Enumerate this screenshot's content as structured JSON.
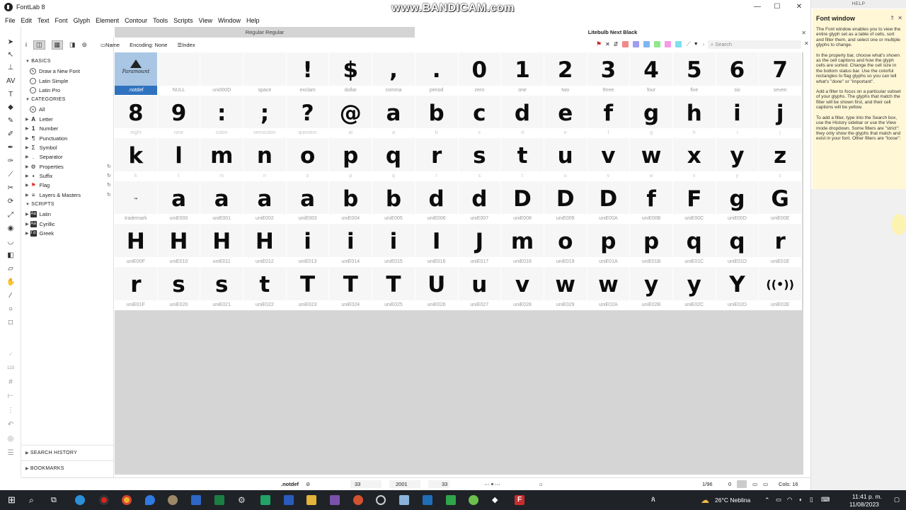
{
  "window": {
    "title": "FontLab 8",
    "minimize": "—",
    "maximize": "☐",
    "close": "✕"
  },
  "watermark": "www.BANDICAM.com",
  "menu": [
    "File",
    "Edit",
    "Text",
    "Font",
    "Glyph",
    "Element",
    "Contour",
    "Tools",
    "Scripts",
    "View",
    "Window",
    "Help"
  ],
  "tabs": {
    "regular": "Regular Regular",
    "litebulb": "Litebulb Next Black"
  },
  "propbar": {
    "info": "i",
    "name": "Name",
    "encoding": "Encoding: None",
    "index": "Index"
  },
  "search": {
    "placeholder": "Search"
  },
  "sidebar": {
    "basics_header": "BASICS",
    "basics": [
      "Draw a New Font",
      "Latin Simple",
      "Latin Pro"
    ],
    "categories_header": "CATEGORIES",
    "categories": [
      {
        "label": "All",
        "icon": "all"
      },
      {
        "label": "Letter",
        "icon": "A"
      },
      {
        "label": "Number",
        "icon": "1"
      },
      {
        "label": "Punctuation",
        "icon": "¶"
      },
      {
        "label": "Symbol",
        "icon": "Σ"
      },
      {
        "label": "Separator",
        "icon": "."
      },
      {
        "label": "Properties",
        "icon": "⚙"
      },
      {
        "label": "Suffix",
        "icon": "▪"
      },
      {
        "label": "Flag",
        "icon": "⚑"
      },
      {
        "label": "Layers & Masters",
        "icon": "≡"
      }
    ],
    "scripts_header": "SCRIPTS",
    "scripts": [
      {
        "label": "Latin",
        "icon": "Aa"
      },
      {
        "label": "Cyrillic",
        "icon": "Аа"
      },
      {
        "label": "Greek",
        "icon": "Γα"
      }
    ],
    "search_history": "SEARCH HISTORY",
    "bookmarks": "BOOKMARKS"
  },
  "glyphs": [
    {
      "g": "",
      "name": ".notdef",
      "special": "logo",
      "selected": true
    },
    {
      "g": "",
      "name": "NULL"
    },
    {
      "g": "",
      "name": "uni000D"
    },
    {
      "g": "",
      "name": "space"
    },
    {
      "g": "!",
      "name": "exclam"
    },
    {
      "g": "$",
      "name": "dollar"
    },
    {
      "g": ",",
      "name": "comma"
    },
    {
      "g": ".",
      "name": "period"
    },
    {
      "g": "0",
      "name": "zero"
    },
    {
      "g": "1",
      "name": "one"
    },
    {
      "g": "2",
      "name": "two"
    },
    {
      "g": "3",
      "name": "three"
    },
    {
      "g": "4",
      "name": "four"
    },
    {
      "g": "5",
      "name": "five"
    },
    {
      "g": "6",
      "name": "six"
    },
    {
      "g": "7",
      "name": "seven"
    },
    {
      "g": "8",
      "name": "eight",
      "faint": true
    },
    {
      "g": "9",
      "name": "nine",
      "faint": true
    },
    {
      "g": ":",
      "name": "colon",
      "faint": true
    },
    {
      "g": ";",
      "name": "semicolon",
      "faint": true
    },
    {
      "g": "?",
      "name": "question",
      "faint": true
    },
    {
      "g": "@",
      "name": "at",
      "faint": true
    },
    {
      "g": "a",
      "name": "a",
      "faint": true
    },
    {
      "g": "b",
      "name": "b",
      "faint": true
    },
    {
      "g": "c",
      "name": "c",
      "faint": true
    },
    {
      "g": "d",
      "name": "d",
      "faint": true
    },
    {
      "g": "e",
      "name": "e",
      "faint": true
    },
    {
      "g": "f",
      "name": "f",
      "faint": true
    },
    {
      "g": "g",
      "name": "g",
      "faint": true
    },
    {
      "g": "h",
      "name": "h",
      "faint": true
    },
    {
      "g": "i",
      "name": "i",
      "faint": true
    },
    {
      "g": "j",
      "name": "j",
      "faint": true
    },
    {
      "g": "k",
      "name": "k",
      "faint": true
    },
    {
      "g": "l",
      "name": "l",
      "faint": true
    },
    {
      "g": "m",
      "name": "m",
      "faint": true
    },
    {
      "g": "n",
      "name": "n",
      "faint": true
    },
    {
      "g": "o",
      "name": "o",
      "faint": true
    },
    {
      "g": "p",
      "name": "p",
      "faint": true
    },
    {
      "g": "q",
      "name": "q",
      "faint": true
    },
    {
      "g": "r",
      "name": "r",
      "faint": true
    },
    {
      "g": "s",
      "name": "s",
      "faint": true
    },
    {
      "g": "t",
      "name": "t",
      "faint": true
    },
    {
      "g": "u",
      "name": "u",
      "faint": true
    },
    {
      "g": "v",
      "name": "v",
      "faint": true
    },
    {
      "g": "w",
      "name": "w",
      "faint": true
    },
    {
      "g": "x",
      "name": "x",
      "faint": true
    },
    {
      "g": "y",
      "name": "y",
      "faint": true
    },
    {
      "g": "z",
      "name": "z",
      "faint": true
    },
    {
      "g": "™",
      "name": "trademark",
      "special": "tm"
    },
    {
      "g": "a",
      "name": "uniE000"
    },
    {
      "g": "a",
      "name": "uniE001"
    },
    {
      "g": "a",
      "name": "uniE002"
    },
    {
      "g": "a",
      "name": "uniE003"
    },
    {
      "g": "b",
      "name": "uniE004"
    },
    {
      "g": "b",
      "name": "uniE005"
    },
    {
      "g": "d",
      "name": "uniE006"
    },
    {
      "g": "d",
      "name": "uniE007"
    },
    {
      "g": "D",
      "name": "uniE008"
    },
    {
      "g": "D",
      "name": "uniE009"
    },
    {
      "g": "D",
      "name": "uniE00A"
    },
    {
      "g": "f",
      "name": "uniE00B"
    },
    {
      "g": "F",
      "name": "uniE00C"
    },
    {
      "g": "g",
      "name": "uniE00D"
    },
    {
      "g": "G",
      "name": "uniE00E"
    },
    {
      "g": "H",
      "name": "uniE00F"
    },
    {
      "g": "H",
      "name": "uniE010"
    },
    {
      "g": "H",
      "name": "uniE011"
    },
    {
      "g": "H",
      "name": "uniE012"
    },
    {
      "g": "i",
      "name": "uniE013"
    },
    {
      "g": "i",
      "name": "uniE014"
    },
    {
      "g": "i",
      "name": "uniE015"
    },
    {
      "g": "I",
      "name": "uniE016"
    },
    {
      "g": "J",
      "name": "uniE017"
    },
    {
      "g": "m",
      "name": "uniE018"
    },
    {
      "g": "o",
      "name": "uniE019"
    },
    {
      "g": "p",
      "name": "uniE01A"
    },
    {
      "g": "p",
      "name": "uniE01B"
    },
    {
      "g": "q",
      "name": "uniE01C"
    },
    {
      "g": "q",
      "name": "uniE01D"
    },
    {
      "g": "r",
      "name": "uniE01E"
    },
    {
      "g": "r",
      "name": "uniE01F"
    },
    {
      "g": "s",
      "name": "uniE020"
    },
    {
      "g": "s",
      "name": "uniE021"
    },
    {
      "g": "t",
      "name": "uniE022"
    },
    {
      "g": "T",
      "name": "uniE023"
    },
    {
      "g": "T",
      "name": "uniE024"
    },
    {
      "g": "T",
      "name": "uniE025"
    },
    {
      "g": "U",
      "name": "uniE026"
    },
    {
      "g": "u",
      "name": "uniE027"
    },
    {
      "g": "v",
      "name": "uniE028"
    },
    {
      "g": "w",
      "name": "uniE029"
    },
    {
      "g": "w",
      "name": "uniE02A"
    },
    {
      "g": "y",
      "name": "uniE02B"
    },
    {
      "g": "y",
      "name": "uniE02C"
    },
    {
      "g": "Y",
      "name": "uniE02D"
    },
    {
      "g": "((•))",
      "name": "uniE02E",
      "special": "vcg"
    }
  ],
  "help": {
    "header": "HELP",
    "title": "Font window",
    "pin": "⇑",
    "close": "✕",
    "p1": "The Font window enables you to view the entire glyph set as a table of cells, sort and filter them, and select one or multiple glyphs to change.",
    "p2": "In the property bar, choose what's shown as the cell captions and how the glyph cells are sorted. Change the cell size in the bottom status bar. Use the colorful rectangles to flag glyphs so you can tell what's \"done\" or \"important\".",
    "p3": "Add a filter to focus on a particular subset of your glyphs. The glyphs that match the filter will be shown first, and their cell captions will be yellow.",
    "p4": "To add a filter, type into the Search box, use the History sidebar or use the View mode dropdown. Some filters are \"strict\": they only show the glyphs that match and exist in your font. Other filters are \"loose\":"
  },
  "status": {
    "glyph": ".notdef",
    "v1": "33",
    "v2": "2001",
    "v3": "33",
    "count": "1/96",
    "zero": "0",
    "cols": "Cols: 16"
  },
  "taskbar": {
    "weather": "26°C  Neblina",
    "time": "11:41 p. m.",
    "date": "11/08/2023"
  },
  "colors": {
    "selection": "#2f73c0",
    "selection_bg": "#a9c6e4",
    "help_bg": "#fff7d6",
    "taskbar": "#1f2328"
  },
  "flag_colors": [
    "#f08a8a",
    "#9f9cf2",
    "#7fb6f2",
    "#8fe88f",
    "#f59ae4",
    "#7fe0ea"
  ]
}
